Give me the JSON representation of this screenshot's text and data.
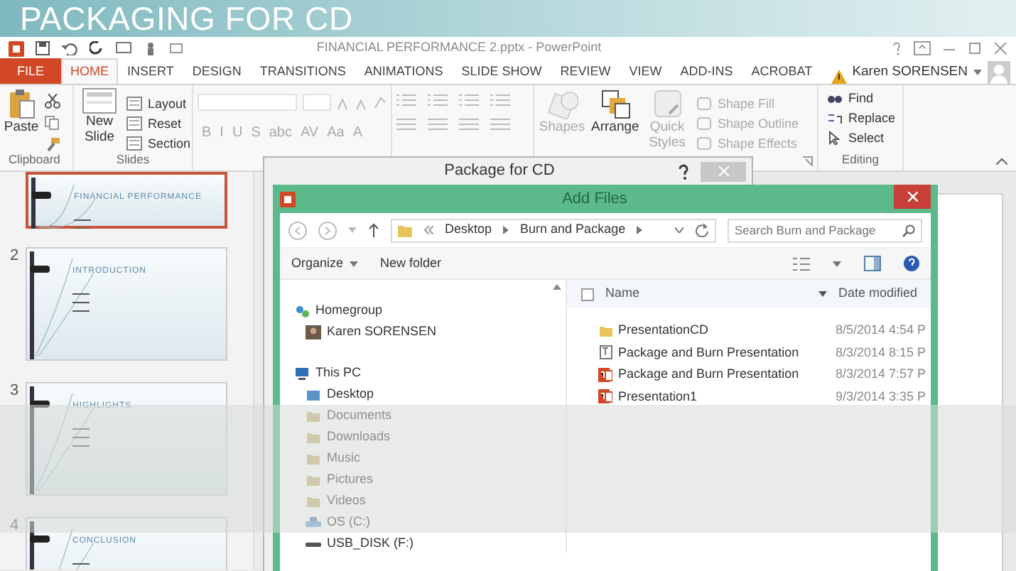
{
  "banner": {
    "title": "PACKAGING FOR CD"
  },
  "window": {
    "title": "FINANCIAL PERFORMANCE 2.pptx - PowerPoint"
  },
  "tabs": [
    {
      "label": "FILE",
      "kind": "file",
      "selected": false
    },
    {
      "label": "HOME",
      "kind": "tab",
      "selected": true
    },
    {
      "label": "INSERT",
      "kind": "tab",
      "selected": false
    },
    {
      "label": "DESIGN",
      "kind": "tab",
      "selected": false
    },
    {
      "label": "TRANSITIONS",
      "kind": "tab",
      "selected": false
    },
    {
      "label": "ANIMATIONS",
      "kind": "tab",
      "selected": false
    },
    {
      "label": "SLIDE SHOW",
      "kind": "tab",
      "selected": false
    },
    {
      "label": "REVIEW",
      "kind": "tab",
      "selected": false
    },
    {
      "label": "VIEW",
      "kind": "tab",
      "selected": false
    },
    {
      "label": "ADD-INS",
      "kind": "tab",
      "selected": false
    },
    {
      "label": "ACROBAT",
      "kind": "tab",
      "selected": false
    }
  ],
  "user": {
    "name": "Karen SORENSEN"
  },
  "ribbon": {
    "clipboard": {
      "label": "Clipboard",
      "paste": "Paste"
    },
    "slides": {
      "label": "Slides",
      "new_slide": "New Slide",
      "commands": [
        "Layout",
        "Reset",
        "Section"
      ]
    },
    "font": {
      "disabled": true,
      "format_buttons": [
        "B",
        "I",
        "U",
        "S",
        "abc",
        "AV",
        "Aa",
        "A"
      ]
    },
    "drawing": {
      "large": [
        {
          "label": "Shapes",
          "disabled": true
        },
        {
          "label": "Arrange",
          "disabled": false
        },
        {
          "label": "Quick Styles",
          "disabled": true
        }
      ],
      "small": [
        {
          "label": "Shape Fill",
          "disabled": true
        },
        {
          "label": "Shape Outline",
          "disabled": true
        },
        {
          "label": "Shape Effects",
          "disabled": true
        }
      ]
    },
    "editing": {
      "label": "Editing",
      "commands": [
        "Find",
        "Replace",
        "Select"
      ]
    }
  },
  "slides": [
    {
      "title": "FINANCIAL PERFORMANCE",
      "selected": true
    },
    {
      "number": "2",
      "title": "INTRODUCTION",
      "selected": false
    },
    {
      "number": "3",
      "title": "HIGHLIGHTS",
      "selected": false
    },
    {
      "number": "4",
      "title": "CONCLUSION",
      "selected": false
    }
  ],
  "package_dialog": {
    "title": "Package for CD"
  },
  "add_files": {
    "title": "Add Files",
    "path": [
      "Desktop",
      "Burn and Package"
    ],
    "search": {
      "placeholder": "Search Burn and Package"
    },
    "toolbar": [
      "Organize",
      "New folder"
    ],
    "nav": [
      {
        "label": "Homegroup",
        "kind": "homegroup",
        "children": [
          {
            "label": "Karen SORENSEN",
            "kind": "user"
          }
        ]
      },
      {
        "label": "This PC",
        "kind": "pc",
        "children": [
          {
            "label": "Desktop",
            "kind": "desktop"
          },
          {
            "label": "Documents",
            "kind": "folder"
          },
          {
            "label": "Downloads",
            "kind": "folder"
          },
          {
            "label": "Music",
            "kind": "folder"
          },
          {
            "label": "Pictures",
            "kind": "folder"
          },
          {
            "label": "Videos",
            "kind": "folder"
          },
          {
            "label": "OS (C:)",
            "kind": "drive"
          },
          {
            "label": "USB_DISK (F:)",
            "kind": "usb"
          }
        ]
      }
    ],
    "select_all": {
      "checked": false
    },
    "columns": [
      "Name",
      "Date modified"
    ],
    "files": [
      {
        "name": "PresentationCD",
        "kind": "folder",
        "date": "8/5/2014 4:54 P"
      },
      {
        "name": "Package and Burn Presentation",
        "kind": "show",
        "date": "8/3/2014 8:15 P"
      },
      {
        "name": "Package and Burn Presentation",
        "kind": "pptx",
        "date": "8/3/2014 7:57 P"
      },
      {
        "name": "Presentation1",
        "kind": "pptx",
        "date": "9/3/2014 3:35 P"
      }
    ]
  }
}
